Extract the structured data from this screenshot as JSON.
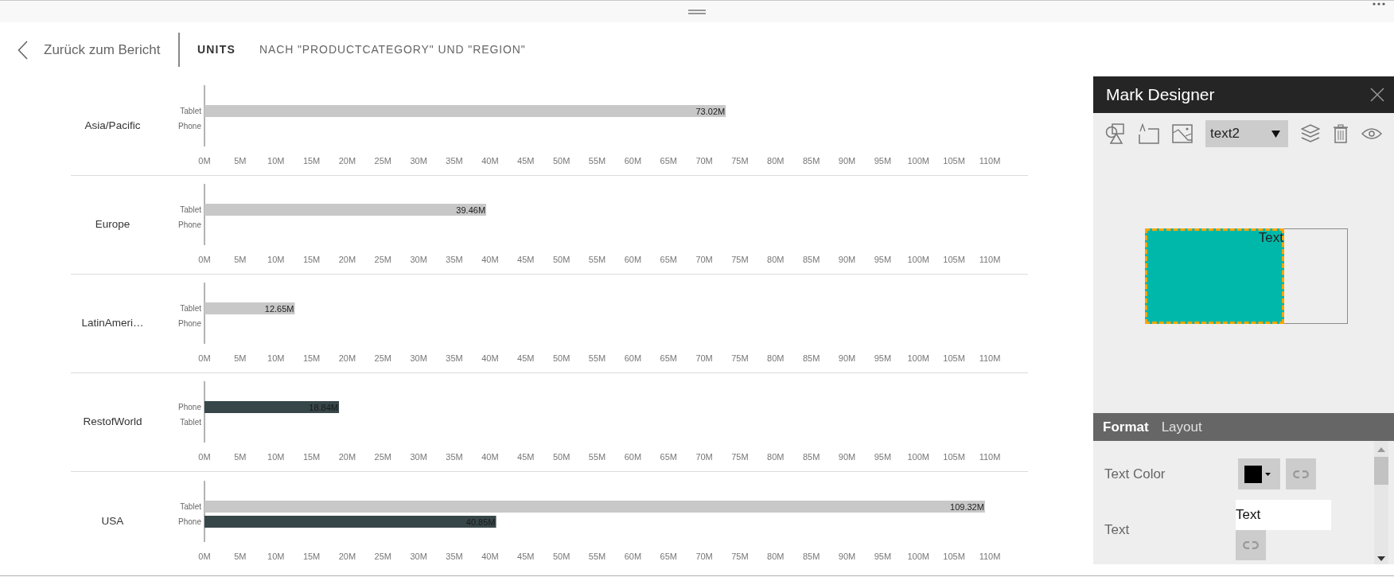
{
  "header": {
    "back_link": "Zurück zum Bericht",
    "title": "UNITS",
    "subtitle": "NACH \"PRODUCTCATEGORY\" UND \"REGION\""
  },
  "charts": [
    {
      "chart_data": {
        "type": "bar",
        "orientation": "horizontal",
        "title": "Asia/Pacific",
        "categories": [
          "Tablet",
          "Phone"
        ],
        "series": [
          {
            "color": "#c8c8c8",
            "values": [
              73.02,
              null
            ]
          }
        ],
        "value_labels": [
          "73.02M",
          null
        ],
        "xlim": [
          0,
          110
        ],
        "xticks": [
          {
            "value": 0,
            "label": "0M"
          },
          {
            "value": 5,
            "label": "5M"
          },
          {
            "value": 10,
            "label": "10M"
          },
          {
            "value": 15,
            "label": "15M"
          },
          {
            "value": 20,
            "label": "20M"
          },
          {
            "value": 25,
            "label": "25M"
          },
          {
            "value": 30,
            "label": "30M"
          },
          {
            "value": 35,
            "label": "35M"
          },
          {
            "value": 40,
            "label": "40M"
          },
          {
            "value": 45,
            "label": "45M"
          },
          {
            "value": 50,
            "label": "50M"
          },
          {
            "value": 55,
            "label": "55M"
          },
          {
            "value": 60,
            "label": "60M"
          },
          {
            "value": 65,
            "label": "65M"
          },
          {
            "value": 70,
            "label": "70M"
          },
          {
            "value": 75,
            "label": "75M"
          },
          {
            "value": 80,
            "label": "80M"
          },
          {
            "value": 85,
            "label": "85M"
          },
          {
            "value": 90,
            "label": "90M"
          },
          {
            "value": 95,
            "label": "95M"
          },
          {
            "value": 100,
            "label": "100M"
          },
          {
            "value": 105,
            "label": "105M"
          },
          {
            "value": 110,
            "label": "110M"
          }
        ]
      }
    },
    {
      "chart_data": {
        "type": "bar",
        "orientation": "horizontal",
        "title": "Europe",
        "categories": [
          "Tablet",
          "Phone"
        ],
        "series": [
          {
            "color": "#c8c8c8",
            "values": [
              39.46,
              null
            ]
          }
        ],
        "value_labels": [
          "39.46M",
          null
        ],
        "xlim": [
          0,
          110
        ],
        "xticks": [
          {
            "value": 0,
            "label": "0M"
          },
          {
            "value": 5,
            "label": "5M"
          },
          {
            "value": 10,
            "label": "10M"
          },
          {
            "value": 15,
            "label": "15M"
          },
          {
            "value": 20,
            "label": "20M"
          },
          {
            "value": 25,
            "label": "25M"
          },
          {
            "value": 30,
            "label": "30M"
          },
          {
            "value": 35,
            "label": "35M"
          },
          {
            "value": 40,
            "label": "40M"
          },
          {
            "value": 45,
            "label": "45M"
          },
          {
            "value": 50,
            "label": "50M"
          },
          {
            "value": 55,
            "label": "55M"
          },
          {
            "value": 60,
            "label": "60M"
          },
          {
            "value": 65,
            "label": "65M"
          },
          {
            "value": 70,
            "label": "70M"
          },
          {
            "value": 75,
            "label": "75M"
          },
          {
            "value": 80,
            "label": "80M"
          },
          {
            "value": 85,
            "label": "85M"
          },
          {
            "value": 90,
            "label": "90M"
          },
          {
            "value": 95,
            "label": "95M"
          },
          {
            "value": 100,
            "label": "100M"
          },
          {
            "value": 105,
            "label": "105M"
          },
          {
            "value": 110,
            "label": "110M"
          }
        ]
      }
    },
    {
      "chart_data": {
        "type": "bar",
        "orientation": "horizontal",
        "title": "LatinAmeri…",
        "categories": [
          "Tablet",
          "Phone"
        ],
        "series": [
          {
            "color": "#c8c8c8",
            "values": [
              12.65,
              null
            ]
          }
        ],
        "value_labels": [
          "12.65M",
          null
        ],
        "xlim": [
          0,
          110
        ],
        "xticks": [
          {
            "value": 0,
            "label": "0M"
          },
          {
            "value": 5,
            "label": "5M"
          },
          {
            "value": 10,
            "label": "10M"
          },
          {
            "value": 15,
            "label": "15M"
          },
          {
            "value": 20,
            "label": "20M"
          },
          {
            "value": 25,
            "label": "25M"
          },
          {
            "value": 30,
            "label": "30M"
          },
          {
            "value": 35,
            "label": "35M"
          },
          {
            "value": 40,
            "label": "40M"
          },
          {
            "value": 45,
            "label": "45M"
          },
          {
            "value": 50,
            "label": "50M"
          },
          {
            "value": 55,
            "label": "55M"
          },
          {
            "value": 60,
            "label": "60M"
          },
          {
            "value": 65,
            "label": "65M"
          },
          {
            "value": 70,
            "label": "70M"
          },
          {
            "value": 75,
            "label": "75M"
          },
          {
            "value": 80,
            "label": "80M"
          },
          {
            "value": 85,
            "label": "85M"
          },
          {
            "value": 90,
            "label": "90M"
          },
          {
            "value": 95,
            "label": "95M"
          },
          {
            "value": 100,
            "label": "100M"
          },
          {
            "value": 105,
            "label": "105M"
          },
          {
            "value": 110,
            "label": "110M"
          }
        ]
      }
    },
    {
      "chart_data": {
        "type": "bar",
        "orientation": "horizontal",
        "title": "RestofWorld",
        "categories": [
          "Phone",
          "Tablet"
        ],
        "series": [
          {
            "color": "#374649",
            "values": [
              18.84,
              null
            ]
          }
        ],
        "value_labels": [
          "18.84M",
          null
        ],
        "xlim": [
          0,
          110
        ],
        "xticks": [
          {
            "value": 0,
            "label": "0M"
          },
          {
            "value": 5,
            "label": "5M"
          },
          {
            "value": 10,
            "label": "10M"
          },
          {
            "value": 15,
            "label": "15M"
          },
          {
            "value": 20,
            "label": "20M"
          },
          {
            "value": 25,
            "label": "25M"
          },
          {
            "value": 30,
            "label": "30M"
          },
          {
            "value": 35,
            "label": "35M"
          },
          {
            "value": 40,
            "label": "40M"
          },
          {
            "value": 45,
            "label": "45M"
          },
          {
            "value": 50,
            "label": "50M"
          },
          {
            "value": 55,
            "label": "55M"
          },
          {
            "value": 60,
            "label": "60M"
          },
          {
            "value": 65,
            "label": "65M"
          },
          {
            "value": 70,
            "label": "70M"
          },
          {
            "value": 75,
            "label": "75M"
          },
          {
            "value": 80,
            "label": "80M"
          },
          {
            "value": 85,
            "label": "85M"
          },
          {
            "value": 90,
            "label": "90M"
          },
          {
            "value": 95,
            "label": "95M"
          },
          {
            "value": 100,
            "label": "100M"
          },
          {
            "value": 105,
            "label": "105M"
          },
          {
            "value": 110,
            "label": "110M"
          }
        ]
      }
    },
    {
      "chart_data": {
        "type": "bar",
        "orientation": "horizontal",
        "stacked": true,
        "title": "USA",
        "categories": [
          "Tablet",
          "Phone"
        ],
        "series": [
          {
            "color": "#c8c8c8",
            "values": [
              109.32,
              null
            ]
          },
          {
            "color": "#374649",
            "values": [
              null,
              40.85
            ]
          }
        ],
        "value_labels": [
          "109.32M",
          "40.85M"
        ],
        "xlim": [
          0,
          110
        ],
        "xticks": [
          {
            "value": 0,
            "label": "0M"
          },
          {
            "value": 5,
            "label": "5M"
          },
          {
            "value": 10,
            "label": "10M"
          },
          {
            "value": 15,
            "label": "15M"
          },
          {
            "value": 20,
            "label": "20M"
          },
          {
            "value": 25,
            "label": "25M"
          },
          {
            "value": 30,
            "label": "30M"
          },
          {
            "value": 35,
            "label": "35M"
          },
          {
            "value": 40,
            "label": "40M"
          },
          {
            "value": 45,
            "label": "45M"
          },
          {
            "value": 50,
            "label": "50M"
          },
          {
            "value": 55,
            "label": "55M"
          },
          {
            "value": 60,
            "label": "60M"
          },
          {
            "value": 65,
            "label": "65M"
          },
          {
            "value": 70,
            "label": "70M"
          },
          {
            "value": 75,
            "label": "75M"
          },
          {
            "value": 80,
            "label": "80M"
          },
          {
            "value": 85,
            "label": "85M"
          },
          {
            "value": 90,
            "label": "90M"
          },
          {
            "value": 95,
            "label": "95M"
          },
          {
            "value": 100,
            "label": "100M"
          },
          {
            "value": 105,
            "label": "105M"
          },
          {
            "value": 110,
            "label": "110M"
          }
        ]
      }
    }
  ],
  "mark_designer": {
    "title": "Mark Designer",
    "mark_select": {
      "value": "text2"
    },
    "canvas": {
      "marks": [
        {
          "kind": "rect",
          "color": "#00b8aa",
          "selected": true
        },
        {
          "kind": "text",
          "text": "Text",
          "selected": false
        }
      ]
    },
    "tabs": [
      {
        "label": "Format",
        "selected": true
      },
      {
        "label": "Layout",
        "selected": false
      }
    ],
    "properties": [
      {
        "kind": "color",
        "label": "Text Color",
        "color": "#000000"
      },
      {
        "kind": "text",
        "label": "Text",
        "value": "Text"
      }
    ]
  }
}
